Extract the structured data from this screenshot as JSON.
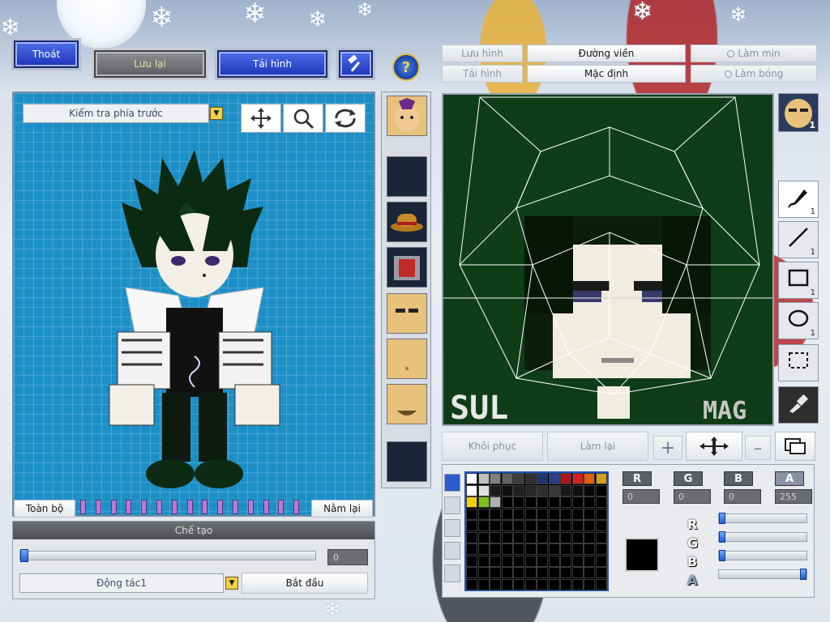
{
  "top": {
    "exit_label": "Thoát",
    "save_label": "Lưu lại",
    "reload_label": "Tải hình",
    "help_glyph": "?"
  },
  "right_top": {
    "save_image": "Lưu hình",
    "load_image": "Tải hình",
    "outline": "Đường viền",
    "default": "Mặc định",
    "smooth": "Làm mịn",
    "shine": "Làm bóng"
  },
  "left_panel": {
    "view_select": "Kiểm tra phía trước",
    "tools": [
      "move-icon",
      "zoom-icon",
      "rotate-icon"
    ],
    "all_label": "Toàn bộ",
    "lie_label": "Nằm lại",
    "frames_count": 15
  },
  "create": {
    "header": "Chế tạo",
    "frame_value": "0",
    "frame_position": 0,
    "action_select": "Động tác1",
    "start_label": "Bắt đầu"
  },
  "editor": {
    "restore_label": "Khôi phục",
    "redo_label": "Làm lại",
    "watermark_left": "SUL",
    "watermark_right": "MAG"
  },
  "side_tools": [
    {
      "name": "brush-tool",
      "icon": "brush-icon",
      "count": "1"
    },
    {
      "name": "line-tool",
      "icon": "line-icon",
      "count": "1"
    },
    {
      "name": "rect-tool",
      "icon": "rectangle-icon",
      "count": "1"
    },
    {
      "name": "ellipse-tool",
      "icon": "ellipse-icon",
      "count": "1"
    },
    {
      "name": "select-tool",
      "icon": "marquee-icon",
      "count": ""
    },
    {
      "name": "eyedropper-tool",
      "icon": "eyedropper-icon",
      "count": ""
    }
  ],
  "face_count": "1",
  "color": {
    "labels": [
      "R",
      "G",
      "B",
      "A"
    ],
    "values": [
      "0",
      "0",
      "0",
      "255"
    ],
    "slider_levels": [
      0,
      0,
      0,
      1
    ],
    "current": "#000000",
    "palette_row1": [
      "#ffffff",
      "#c0c0c0",
      "#808080",
      "#606060",
      "#404040",
      "#303030",
      "#1a3a6e",
      "#2d3f8a",
      "#b01616",
      "#d82020",
      "#e06010",
      "#d4a020"
    ],
    "palette_row2": [
      "#ffffff",
      "#e0e0e0",
      "#1a1a1a",
      "#101010",
      "#202020",
      "#282828",
      "#303030",
      "#383838",
      "#181818",
      "#101010",
      "#080808",
      "#000000"
    ],
    "palette_row3": [
      "#f0d000",
      "#80c020",
      "#b0b0b0",
      "#000000",
      "#000000",
      "#000000",
      "#000000",
      "#000000",
      "#000000",
      "#000000",
      "#000000",
      "#000000"
    ]
  }
}
